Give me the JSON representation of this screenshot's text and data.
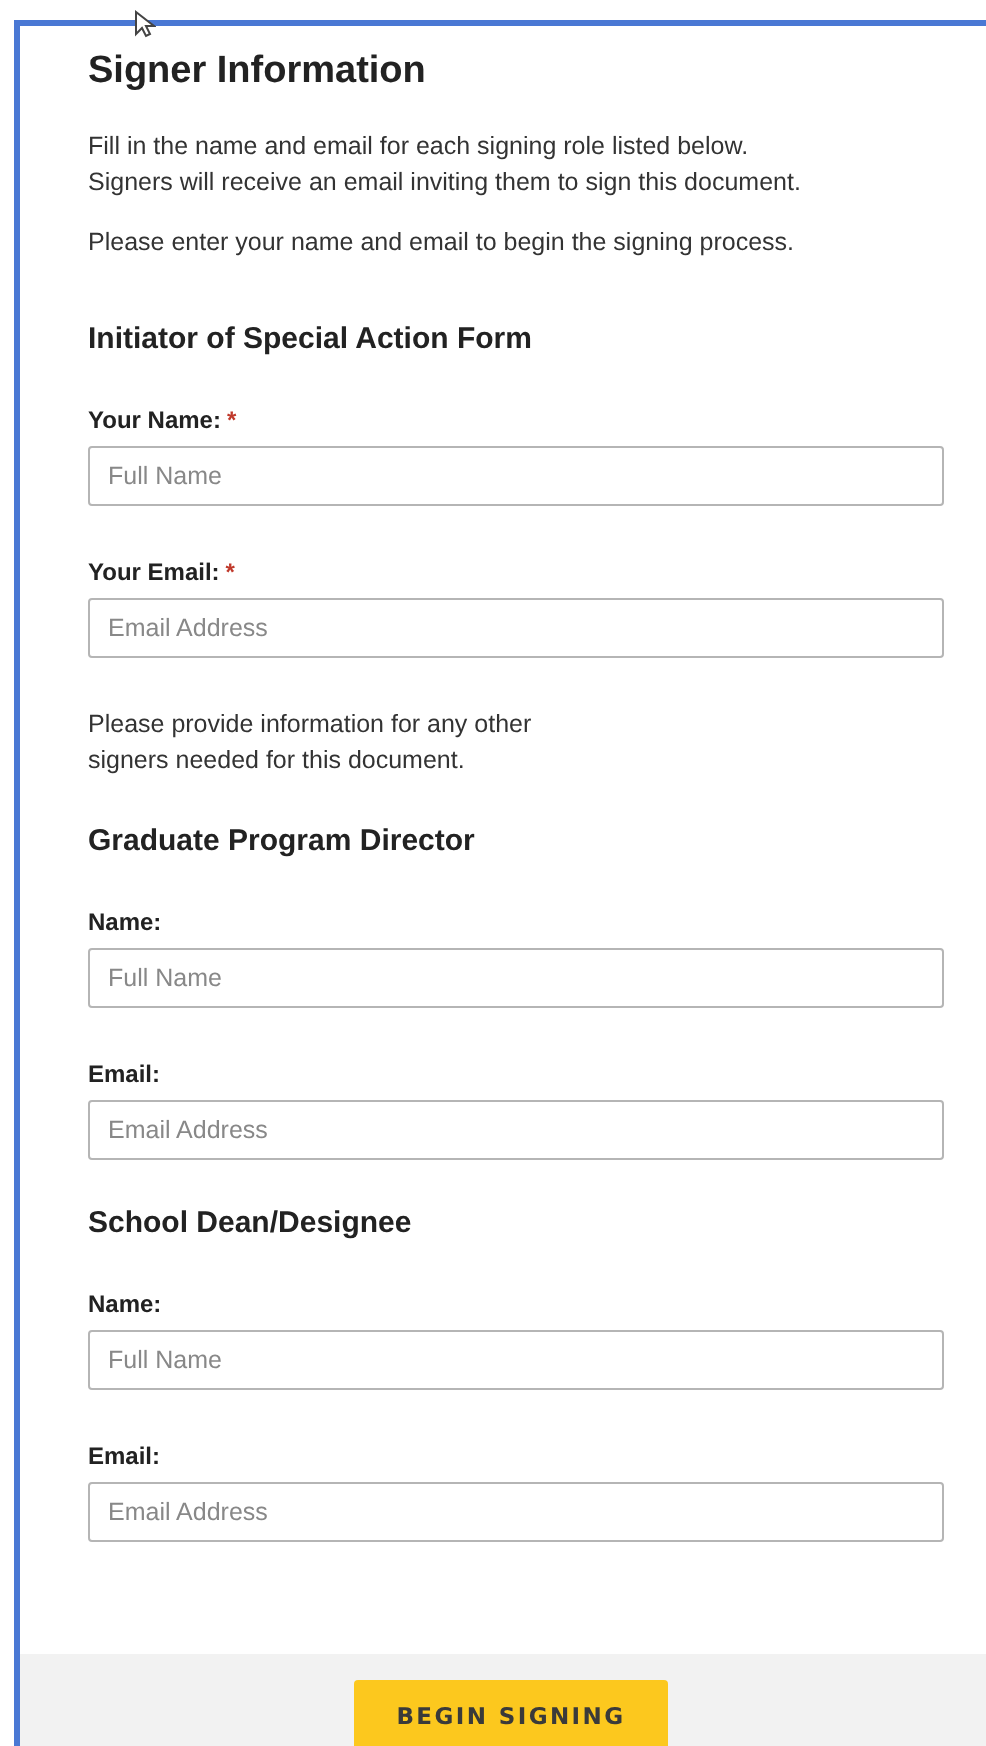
{
  "title": "Signer Information",
  "intro": [
    "Fill in the name and email for each signing role listed below.\nSigners will receive an email inviting them to sign this document.",
    "Please enter your name and email to begin the signing process."
  ],
  "blocks": [
    {
      "kind": "section",
      "heading": "Initiator of Special Action Form",
      "fields": [
        {
          "label": "Your Name:",
          "required_mark": "*",
          "placeholder": "Full Name"
        },
        {
          "label": "Your Email:",
          "required_mark": "*",
          "placeholder": "Email Address"
        }
      ]
    },
    {
      "kind": "note",
      "text": "Please provide information for any other\nsigners needed for this document."
    },
    {
      "kind": "section",
      "heading": "Graduate Program Director",
      "fields": [
        {
          "label": "Name:",
          "placeholder": "Full Name"
        },
        {
          "label": "Email:",
          "placeholder": "Email Address"
        }
      ]
    },
    {
      "kind": "section",
      "heading": "School Dean/Designee",
      "fields": [
        {
          "label": "Name:",
          "placeholder": "Full Name"
        },
        {
          "label": "Email:",
          "placeholder": "Email Address"
        }
      ]
    }
  ],
  "submit": "BEGIN SIGNING"
}
